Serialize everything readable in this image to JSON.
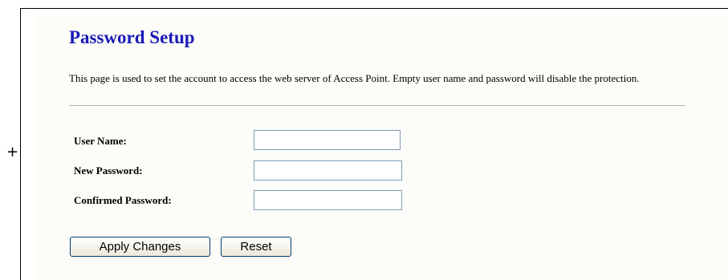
{
  "page": {
    "title": "Password Setup",
    "description": "This page is used to set the account to access the web server of Access Point. Empty user name and password will disable the protection."
  },
  "form": {
    "user_name": {
      "label": "User Name:",
      "value": ""
    },
    "new_password": {
      "label": "New Password:",
      "value": ""
    },
    "confirmed_password": {
      "label": "Confirmed Password:",
      "value": ""
    }
  },
  "buttons": {
    "apply_label": "Apply Changes",
    "reset_label": "Reset"
  },
  "colors": {
    "title": "#1a1ab8",
    "panel_background": "#fcfcf8",
    "input_border": "#7f9db9",
    "button_border": "#003c74"
  }
}
